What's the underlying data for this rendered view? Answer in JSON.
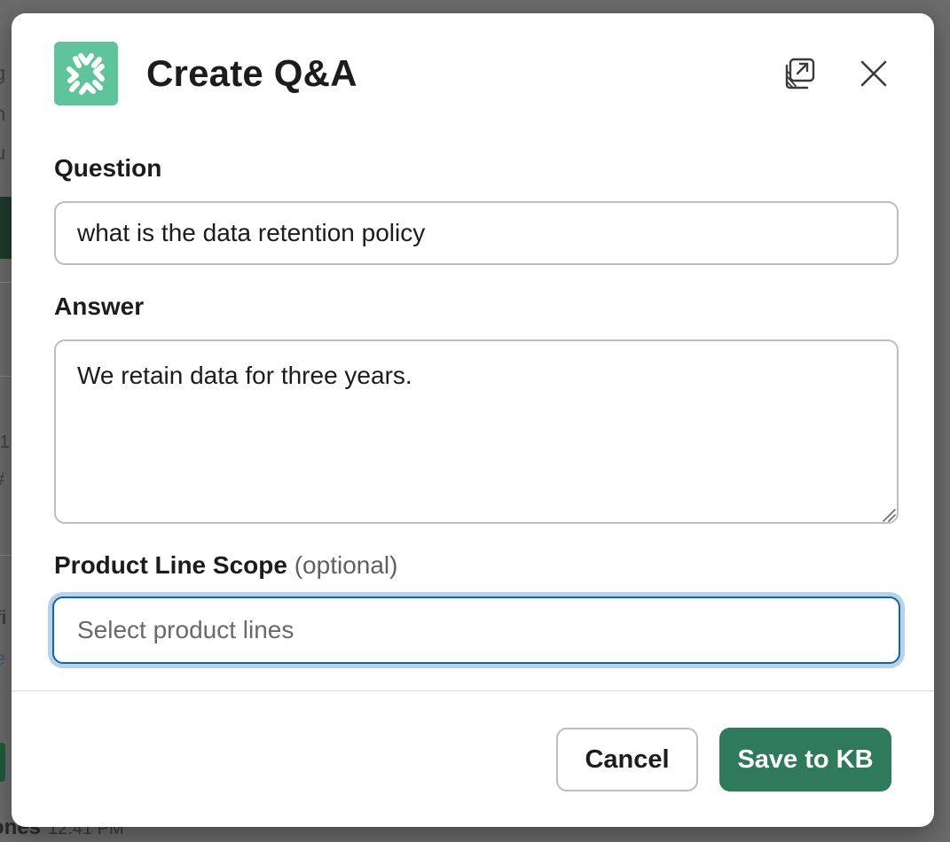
{
  "background": {
    "fragments": [
      "g",
      "n",
      "u",
      "P",
      ":1",
      "#",
      "fi",
      "e"
    ],
    "footer_name": "ones",
    "footer_time": "12:41 PM"
  },
  "modal": {
    "title": "Create Q&A",
    "icons": {
      "app": "spark-burst-icon",
      "popout": "open-in-window-icon",
      "close": "close-icon"
    },
    "colors": {
      "app_icon_bg": "#5fc39c",
      "primary": "#2f7a5b",
      "focus_border": "#1264a3"
    }
  },
  "form": {
    "question": {
      "label": "Question",
      "value": "what is the data retention policy"
    },
    "answer": {
      "label": "Answer",
      "value": "We retain data for three years."
    },
    "product_line": {
      "label": "Product Line Scope",
      "optional_label": "(optional)",
      "placeholder": "Select product lines"
    }
  },
  "footer": {
    "cancel_label": "Cancel",
    "save_label": "Save to KB"
  }
}
